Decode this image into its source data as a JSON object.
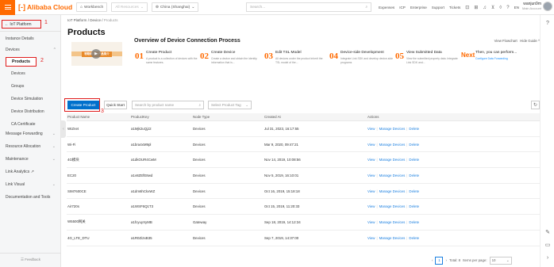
{
  "topbar": {
    "logo": "Alibaba Cloud",
    "workbench": "Workbench",
    "resources": "All Resources",
    "region": "China (Shanghai)",
    "search_placeholder": "Search...",
    "links": [
      "Expenses",
      "ICP",
      "Enterprise",
      "Support",
      "Tickets"
    ],
    "lang": "EN",
    "user_name": "wanjun9m",
    "user_role": "Main Account"
  },
  "sidebar": {
    "back_label": "IoT Platform",
    "instance_details": "Instance Details",
    "devices": "Devices",
    "products": "Products",
    "sub_items": [
      "Devices",
      "Groups",
      "Device Simulation",
      "Device Distribution",
      "CA Certificate"
    ],
    "items": [
      "Message Forwarding",
      "Resource Allocation",
      "Maintenance",
      "Link Analytics",
      "Link Visual",
      "Documentation and Tools"
    ],
    "feedback": "Feedback"
  },
  "markers": [
    "1",
    "2",
    "3"
  ],
  "breadcrumb": [
    "IoT Platform",
    "Device",
    "Products"
  ],
  "page_title": "Products",
  "overview": {
    "title": "Overview of Device Connection Process",
    "video_label": "物联网平台产品简介",
    "view_flowchart": "View Flowchart",
    "hide_guide": "Hide Guide",
    "steps": [
      {
        "num": "01",
        "name": "Create Product",
        "desc": "A product is a collection of devices with the same features."
      },
      {
        "num": "02",
        "name": "Create Device",
        "desc": "Create a device and obtain the identity information that is..."
      },
      {
        "num": "03",
        "name": "Edit TSL Model",
        "desc": "All devices under the product inherit the TSL model of the..."
      },
      {
        "num": "04",
        "name": "Device-side Development",
        "desc": "Integrate Link SDK and develop device-side programs"
      },
      {
        "num": "05",
        "name": "View Submitted Data",
        "desc": "View the submitted property data. Integrate Link SDK and..."
      },
      {
        "num": "Next",
        "name": "Then, you can perform...",
        "desc": "Configure Data Forwarding"
      }
    ]
  },
  "toolbar": {
    "create": "Create Product",
    "quick_start": "Quick Start",
    "search_placeholder": "Search by product name",
    "tag_placeholder": "Select Product Tag"
  },
  "table": {
    "headers": [
      "Product Name",
      "ProductKey",
      "Node Type",
      "Created At",
      "Actions"
    ],
    "rows": [
      [
        "WIZnet",
        "a1Mjk2uQjJ2",
        "Devices",
        "Jul 31, 2023, 16:17:55"
      ],
      [
        "Wi-Fi",
        "a1bra4xM9pl",
        "Devices",
        "Mar 9, 2020, 09:47:21"
      ],
      [
        "4G模块",
        "a1dkOUR4CwM",
        "Devices",
        "Nov 14, 2019, 10:08:56"
      ],
      [
        "EC20",
        "a1v8ZEfE8wd",
        "Devices",
        "Nov 5, 2019, 16:10:01"
      ],
      [
        "SIM7600CE",
        "a1dm6hCkxWZ",
        "Devices",
        "Oct 16, 2019, 15:18:18"
      ],
      [
        "Air720s",
        "a1WSF6Q1T3",
        "Devices",
        "Oct 15, 2019, 11:20:33"
      ],
      [
        "W5500网关",
        "a1fcyuyXyMB",
        "Gateway",
        "Sep 18, 2019, 14:12:34"
      ],
      [
        "4G_LTE_DTU",
        "a1R0Zi2xB35",
        "Devices",
        "Sep 7, 2019, 14:37:00"
      ]
    ],
    "actions": [
      "View",
      "Manage Devices",
      "Delete"
    ]
  },
  "pager": {
    "current": "1",
    "total": "Total: 8",
    "per_page_label": "Items per page:",
    "per_page": "10"
  },
  "colors": {
    "accent": "#ff6a00",
    "primary": "#0070cc",
    "highlight": "#e01b1b",
    "link": "#1a7fe0"
  }
}
